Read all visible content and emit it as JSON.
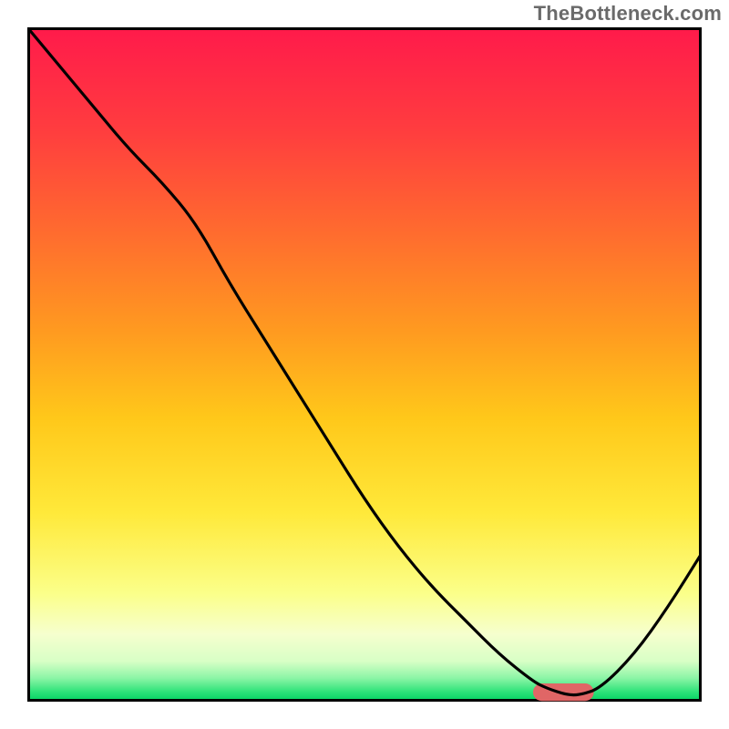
{
  "watermark": "TheBottleneck.com",
  "chart_data": {
    "type": "line",
    "title": "",
    "xlabel": "",
    "ylabel": "",
    "xlim": [
      0,
      100
    ],
    "ylim": [
      0,
      100
    ],
    "grid": false,
    "legend": false,
    "gradient_stops": [
      {
        "offset": 0.0,
        "color": "#ff1a4b"
      },
      {
        "offset": 0.15,
        "color": "#ff3c3f"
      },
      {
        "offset": 0.3,
        "color": "#ff6a2f"
      },
      {
        "offset": 0.45,
        "color": "#ff9a20"
      },
      {
        "offset": 0.58,
        "color": "#ffc81a"
      },
      {
        "offset": 0.72,
        "color": "#ffe93a"
      },
      {
        "offset": 0.84,
        "color": "#fbff8a"
      },
      {
        "offset": 0.9,
        "color": "#f6ffce"
      },
      {
        "offset": 0.94,
        "color": "#d8ffc6"
      },
      {
        "offset": 0.965,
        "color": "#8cf5a6"
      },
      {
        "offset": 0.985,
        "color": "#2fe37a"
      },
      {
        "offset": 1.0,
        "color": "#00d160"
      }
    ],
    "series": [
      {
        "name": "curve",
        "color": "#000000",
        "x": [
          0,
          5,
          10,
          15,
          20,
          25,
          30,
          35,
          40,
          45,
          50,
          55,
          60,
          65,
          70,
          75,
          77,
          80,
          82,
          85,
          90,
          95,
          100
        ],
        "y": [
          100,
          94,
          88,
          82,
          77,
          71,
          62,
          54,
          46,
          38,
          30,
          23,
          17,
          12,
          7,
          3,
          2,
          1,
          1,
          2,
          7,
          14,
          22
        ]
      }
    ],
    "marker": {
      "color": "#e06666",
      "x_range": [
        75,
        84
      ],
      "y": 1.4,
      "thickness": 2.6
    }
  }
}
